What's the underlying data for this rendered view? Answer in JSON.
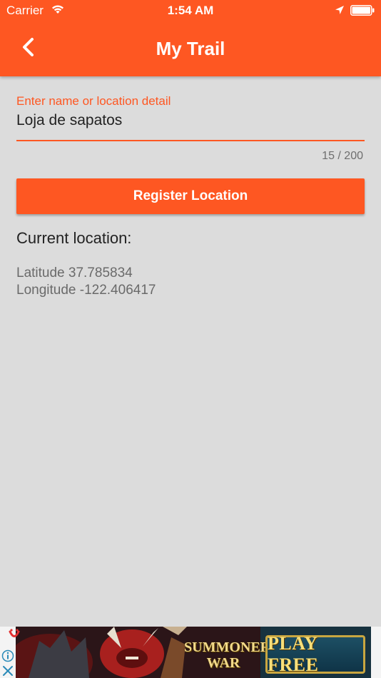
{
  "status_bar": {
    "carrier": "Carrier",
    "time": "1:54 AM"
  },
  "nav": {
    "title": "My Trail",
    "back_icon": "chevron-left-icon"
  },
  "form": {
    "name_label": "Enter name or location detail",
    "name_value": "Loja de sapatos",
    "char_counter": "15 / 200",
    "register_label": "Register Location"
  },
  "location": {
    "heading": "Current location:",
    "latitude_text": "Latitude 37.785834",
    "longitude_text": "Longitude -122.406417"
  },
  "ad": {
    "logo_line1": "SUMMONERS",
    "logo_line2": "WAR",
    "cta": "PLAY FREE",
    "info_icon": "info-icon",
    "close_icon": "close-icon"
  },
  "colors": {
    "accent": "#fe5722",
    "background": "#dcdcdc",
    "text_primary": "#222222",
    "text_secondary": "#6a6a6a"
  }
}
